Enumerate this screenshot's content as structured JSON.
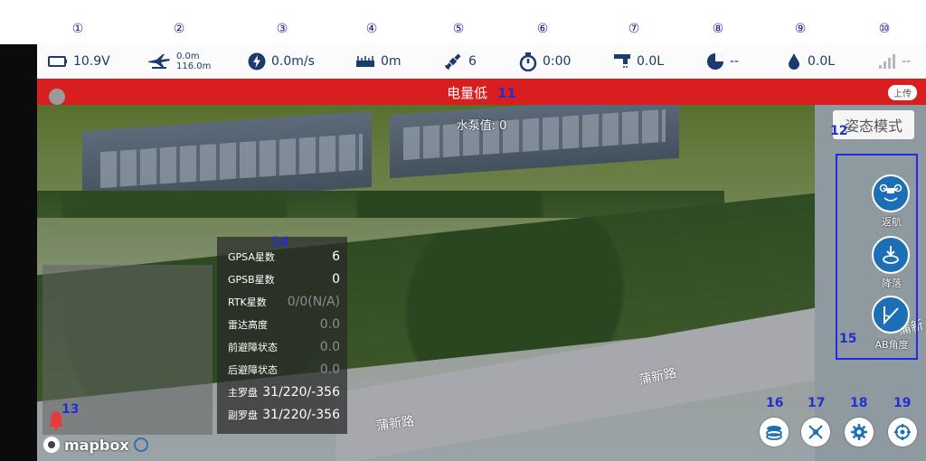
{
  "annotations": [
    "①",
    "②",
    "③",
    "④",
    "⑤",
    "⑥",
    "⑦",
    "⑧",
    "⑨",
    "⑩"
  ],
  "status_bar": {
    "voltage": "10.9V",
    "altitude": "0.0m",
    "distance": "116.0m",
    "speed": "0.0m/s",
    "radar_height": "0m",
    "satellites": "6",
    "timer": "0:00",
    "flow": "0.0L",
    "area": "--",
    "liquid": "0.0L",
    "signal": "--"
  },
  "alert": {
    "text": "电量低",
    "number": "11",
    "upload": "上传"
  },
  "map": {
    "pump_value": "水泵值: 0",
    "road_labels": [
      "蒲新路",
      "蒲新路",
      "蒲新"
    ]
  },
  "mode_button": "姿态模式",
  "side_panel": {
    "number": "12",
    "buttons": [
      {
        "label": "返航",
        "icon": "drone-return-icon"
      },
      {
        "label": "降落",
        "icon": "landing-icon"
      },
      {
        "label": "AB角度",
        "icon": "ab-angle-icon"
      }
    ]
  },
  "info_panel": {
    "number": "14",
    "rows": [
      {
        "key": "GPSA星数",
        "value": "6"
      },
      {
        "key": "GPSB星数",
        "value": "0"
      },
      {
        "key": "RTK星数",
        "value": "0/0(N/A)"
      },
      {
        "key": "雷达高度",
        "value": "0.0"
      },
      {
        "key": "前避障状态",
        "value": "0.0"
      },
      {
        "key": "后避障状态",
        "value": "0.0"
      },
      {
        "key": "主罗盘",
        "value": "31/220/-356"
      },
      {
        "key": "副罗盘",
        "value": "31/220/-356"
      }
    ]
  },
  "labels": {
    "bell": "13",
    "ab": "15",
    "b16": "16",
    "b17": "17",
    "b18": "18",
    "b19": "19"
  },
  "brand": "mapbox",
  "colors": {
    "alert": "#d81e1e",
    "accent": "#1d6fb5",
    "annotation": "#1f2fd0"
  }
}
